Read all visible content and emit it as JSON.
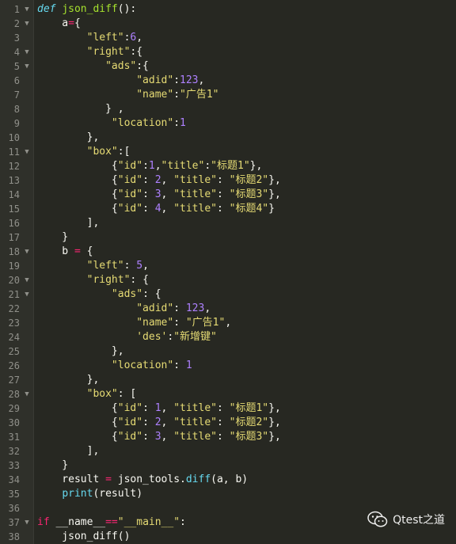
{
  "colors": {
    "background": "#272822",
    "gutter": "#2f302a",
    "line_number": "#90908a",
    "keyword": "#66d9ef",
    "function": "#a6e22e",
    "string": "#e6db74",
    "number": "#ae81ff",
    "operator": "#f92672",
    "plain": "#f8f8f2"
  },
  "watermark": {
    "icon": "wechat-icon",
    "text": "Qtest之道"
  },
  "code_lines": [
    {
      "n": "1",
      "fold": true,
      "tokens": [
        [
          "kw",
          "def"
        ],
        [
          "p",
          " "
        ],
        [
          "fn",
          "json_diff"
        ],
        [
          "p",
          "():"
        ]
      ]
    },
    {
      "n": "2",
      "fold": true,
      "tokens": [
        [
          "p",
          "    a"
        ],
        [
          "op",
          "="
        ],
        [
          "p",
          "{"
        ]
      ]
    },
    {
      "n": "3",
      "fold": false,
      "tokens": [
        [
          "p",
          "        "
        ],
        [
          "str",
          "\"left\""
        ],
        [
          "p",
          ":"
        ],
        [
          "num",
          "6"
        ],
        [
          "p",
          ","
        ]
      ]
    },
    {
      "n": "4",
      "fold": true,
      "tokens": [
        [
          "p",
          "        "
        ],
        [
          "str",
          "\"right\""
        ],
        [
          "p",
          ":{"
        ]
      ]
    },
    {
      "n": "5",
      "fold": true,
      "tokens": [
        [
          "p",
          "           "
        ],
        [
          "str",
          "\"ads\""
        ],
        [
          "p",
          ":{"
        ]
      ]
    },
    {
      "n": "6",
      "fold": false,
      "tokens": [
        [
          "p",
          "                "
        ],
        [
          "str",
          "\"adid\""
        ],
        [
          "p",
          ":"
        ],
        [
          "num",
          "123"
        ],
        [
          "p",
          ","
        ]
      ]
    },
    {
      "n": "7",
      "fold": false,
      "tokens": [
        [
          "p",
          "                "
        ],
        [
          "str",
          "\"name\""
        ],
        [
          "p",
          ":"
        ],
        [
          "str",
          "\"广告1\""
        ]
      ]
    },
    {
      "n": "8",
      "fold": false,
      "tokens": [
        [
          "p",
          "           } ,"
        ]
      ]
    },
    {
      "n": "9",
      "fold": false,
      "tokens": [
        [
          "p",
          "            "
        ],
        [
          "str",
          "\"location\""
        ],
        [
          "p",
          ":"
        ],
        [
          "num",
          "1"
        ]
      ]
    },
    {
      "n": "10",
      "fold": false,
      "tokens": [
        [
          "p",
          "        },"
        ]
      ]
    },
    {
      "n": "11",
      "fold": true,
      "tokens": [
        [
          "p",
          "        "
        ],
        [
          "str",
          "\"box\""
        ],
        [
          "p",
          ":["
        ]
      ]
    },
    {
      "n": "12",
      "fold": false,
      "tokens": [
        [
          "p",
          "            {"
        ],
        [
          "str",
          "\"id\""
        ],
        [
          "p",
          ":"
        ],
        [
          "num",
          "1"
        ],
        [
          "p",
          ","
        ],
        [
          "str",
          "\"title\""
        ],
        [
          "p",
          ":"
        ],
        [
          "str",
          "\"标题1\""
        ],
        [
          "p",
          "},"
        ]
      ]
    },
    {
      "n": "13",
      "fold": false,
      "tokens": [
        [
          "p",
          "            {"
        ],
        [
          "str",
          "\"id\""
        ],
        [
          "p",
          ": "
        ],
        [
          "num",
          "2"
        ],
        [
          "p",
          ", "
        ],
        [
          "str",
          "\"title\""
        ],
        [
          "p",
          ": "
        ],
        [
          "str",
          "\"标题2\""
        ],
        [
          "p",
          "},"
        ]
      ]
    },
    {
      "n": "14",
      "fold": false,
      "tokens": [
        [
          "p",
          "            {"
        ],
        [
          "str",
          "\"id\""
        ],
        [
          "p",
          ": "
        ],
        [
          "num",
          "3"
        ],
        [
          "p",
          ", "
        ],
        [
          "str",
          "\"title\""
        ],
        [
          "p",
          ": "
        ],
        [
          "str",
          "\"标题3\""
        ],
        [
          "p",
          "},"
        ]
      ]
    },
    {
      "n": "15",
      "fold": false,
      "tokens": [
        [
          "p",
          "            {"
        ],
        [
          "str",
          "\"id\""
        ],
        [
          "p",
          ": "
        ],
        [
          "num",
          "4"
        ],
        [
          "p",
          ", "
        ],
        [
          "str",
          "\"title\""
        ],
        [
          "p",
          ": "
        ],
        [
          "str",
          "\"标题4\""
        ],
        [
          "p",
          "}"
        ]
      ]
    },
    {
      "n": "16",
      "fold": false,
      "tokens": [
        [
          "p",
          "        ],"
        ]
      ]
    },
    {
      "n": "17",
      "fold": false,
      "tokens": [
        [
          "p",
          "    }"
        ]
      ]
    },
    {
      "n": "18",
      "fold": true,
      "tokens": [
        [
          "p",
          "    b "
        ],
        [
          "op",
          "="
        ],
        [
          "p",
          " {"
        ]
      ]
    },
    {
      "n": "19",
      "fold": false,
      "tokens": [
        [
          "p",
          "        "
        ],
        [
          "str",
          "\"left\""
        ],
        [
          "p",
          ": "
        ],
        [
          "num",
          "5"
        ],
        [
          "p",
          ","
        ]
      ]
    },
    {
      "n": "20",
      "fold": true,
      "tokens": [
        [
          "p",
          "        "
        ],
        [
          "str",
          "\"right\""
        ],
        [
          "p",
          ": {"
        ]
      ]
    },
    {
      "n": "21",
      "fold": true,
      "tokens": [
        [
          "p",
          "            "
        ],
        [
          "str",
          "\"ads\""
        ],
        [
          "p",
          ": {"
        ]
      ]
    },
    {
      "n": "22",
      "fold": false,
      "tokens": [
        [
          "p",
          "                "
        ],
        [
          "str",
          "\"adid\""
        ],
        [
          "p",
          ": "
        ],
        [
          "num",
          "123"
        ],
        [
          "p",
          ","
        ]
      ]
    },
    {
      "n": "23",
      "fold": false,
      "tokens": [
        [
          "p",
          "                "
        ],
        [
          "str",
          "\"name\""
        ],
        [
          "p",
          ": "
        ],
        [
          "str",
          "\"广告1\""
        ],
        [
          "p",
          ","
        ]
      ]
    },
    {
      "n": "24",
      "fold": false,
      "tokens": [
        [
          "p",
          "                "
        ],
        [
          "str",
          "'des'"
        ],
        [
          "p",
          ":"
        ],
        [
          "str",
          "\"新增键\""
        ]
      ]
    },
    {
      "n": "25",
      "fold": false,
      "tokens": [
        [
          "p",
          "            },"
        ]
      ]
    },
    {
      "n": "26",
      "fold": false,
      "tokens": [
        [
          "p",
          "            "
        ],
        [
          "str",
          "\"location\""
        ],
        [
          "p",
          ": "
        ],
        [
          "num",
          "1"
        ]
      ]
    },
    {
      "n": "27",
      "fold": false,
      "tokens": [
        [
          "p",
          "        },"
        ]
      ]
    },
    {
      "n": "28",
      "fold": true,
      "tokens": [
        [
          "p",
          "        "
        ],
        [
          "str",
          "\"box\""
        ],
        [
          "p",
          ": ["
        ]
      ]
    },
    {
      "n": "29",
      "fold": false,
      "tokens": [
        [
          "p",
          "            {"
        ],
        [
          "str",
          "\"id\""
        ],
        [
          "p",
          ": "
        ],
        [
          "num",
          "1"
        ],
        [
          "p",
          ", "
        ],
        [
          "str",
          "\"title\""
        ],
        [
          "p",
          ": "
        ],
        [
          "str",
          "\"标题1\""
        ],
        [
          "p",
          "},"
        ]
      ]
    },
    {
      "n": "30",
      "fold": false,
      "tokens": [
        [
          "p",
          "            {"
        ],
        [
          "str",
          "\"id\""
        ],
        [
          "p",
          ": "
        ],
        [
          "num",
          "2"
        ],
        [
          "p",
          ", "
        ],
        [
          "str",
          "\"title\""
        ],
        [
          "p",
          ": "
        ],
        [
          "str",
          "\"标题2\""
        ],
        [
          "p",
          "},"
        ]
      ]
    },
    {
      "n": "31",
      "fold": false,
      "tokens": [
        [
          "p",
          "            {"
        ],
        [
          "str",
          "\"id\""
        ],
        [
          "p",
          ": "
        ],
        [
          "num",
          "3"
        ],
        [
          "p",
          ", "
        ],
        [
          "str",
          "\"title\""
        ],
        [
          "p",
          ": "
        ],
        [
          "str",
          "\"标题3\""
        ],
        [
          "p",
          "},"
        ]
      ]
    },
    {
      "n": "32",
      "fold": false,
      "tokens": [
        [
          "p",
          "        ],"
        ]
      ]
    },
    {
      "n": "33",
      "fold": false,
      "tokens": [
        [
          "p",
          "    }"
        ]
      ]
    },
    {
      "n": "34",
      "fold": false,
      "tokens": [
        [
          "p",
          "    result "
        ],
        [
          "op",
          "="
        ],
        [
          "p",
          " json_tools."
        ],
        [
          "builtin",
          "diff"
        ],
        [
          "p",
          "(a, b)"
        ]
      ]
    },
    {
      "n": "35",
      "fold": false,
      "tokens": [
        [
          "p",
          "    "
        ],
        [
          "builtin",
          "print"
        ],
        [
          "p",
          "(result)"
        ]
      ]
    },
    {
      "n": "36",
      "fold": false,
      "tokens": []
    },
    {
      "n": "37",
      "fold": true,
      "tokens": [
        [
          "ctrl",
          "if"
        ],
        [
          "p",
          " __name__"
        ],
        [
          "op",
          "=="
        ],
        [
          "str",
          "\"__main__\""
        ],
        [
          "p",
          ":"
        ]
      ]
    },
    {
      "n": "38",
      "fold": false,
      "tokens": [
        [
          "p",
          "    json_diff()"
        ]
      ]
    }
  ]
}
